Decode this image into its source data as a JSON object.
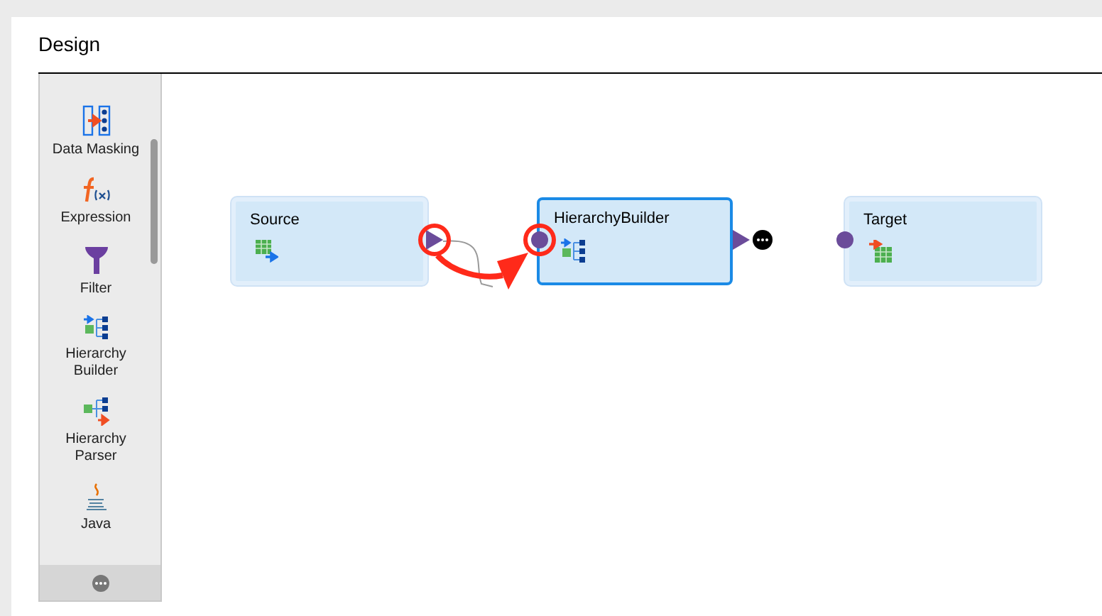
{
  "title": "Design",
  "palette": [
    {
      "label": "Data Masking",
      "kind": "masking"
    },
    {
      "label": "Expression",
      "kind": "expression"
    },
    {
      "label": "Filter",
      "kind": "filter"
    },
    {
      "label": "Hierarchy Builder",
      "kind": "hbuilder"
    },
    {
      "label": "Hierarchy Parser",
      "kind": "hparser"
    },
    {
      "label": "Java",
      "kind": "java"
    }
  ],
  "nodes": [
    {
      "label": "Source",
      "kind": "source",
      "selected": false
    },
    {
      "label": "HierarchyBuilder",
      "kind": "hbuilder",
      "selected": true
    },
    {
      "label": "Target",
      "kind": "target",
      "selected": false
    }
  ]
}
